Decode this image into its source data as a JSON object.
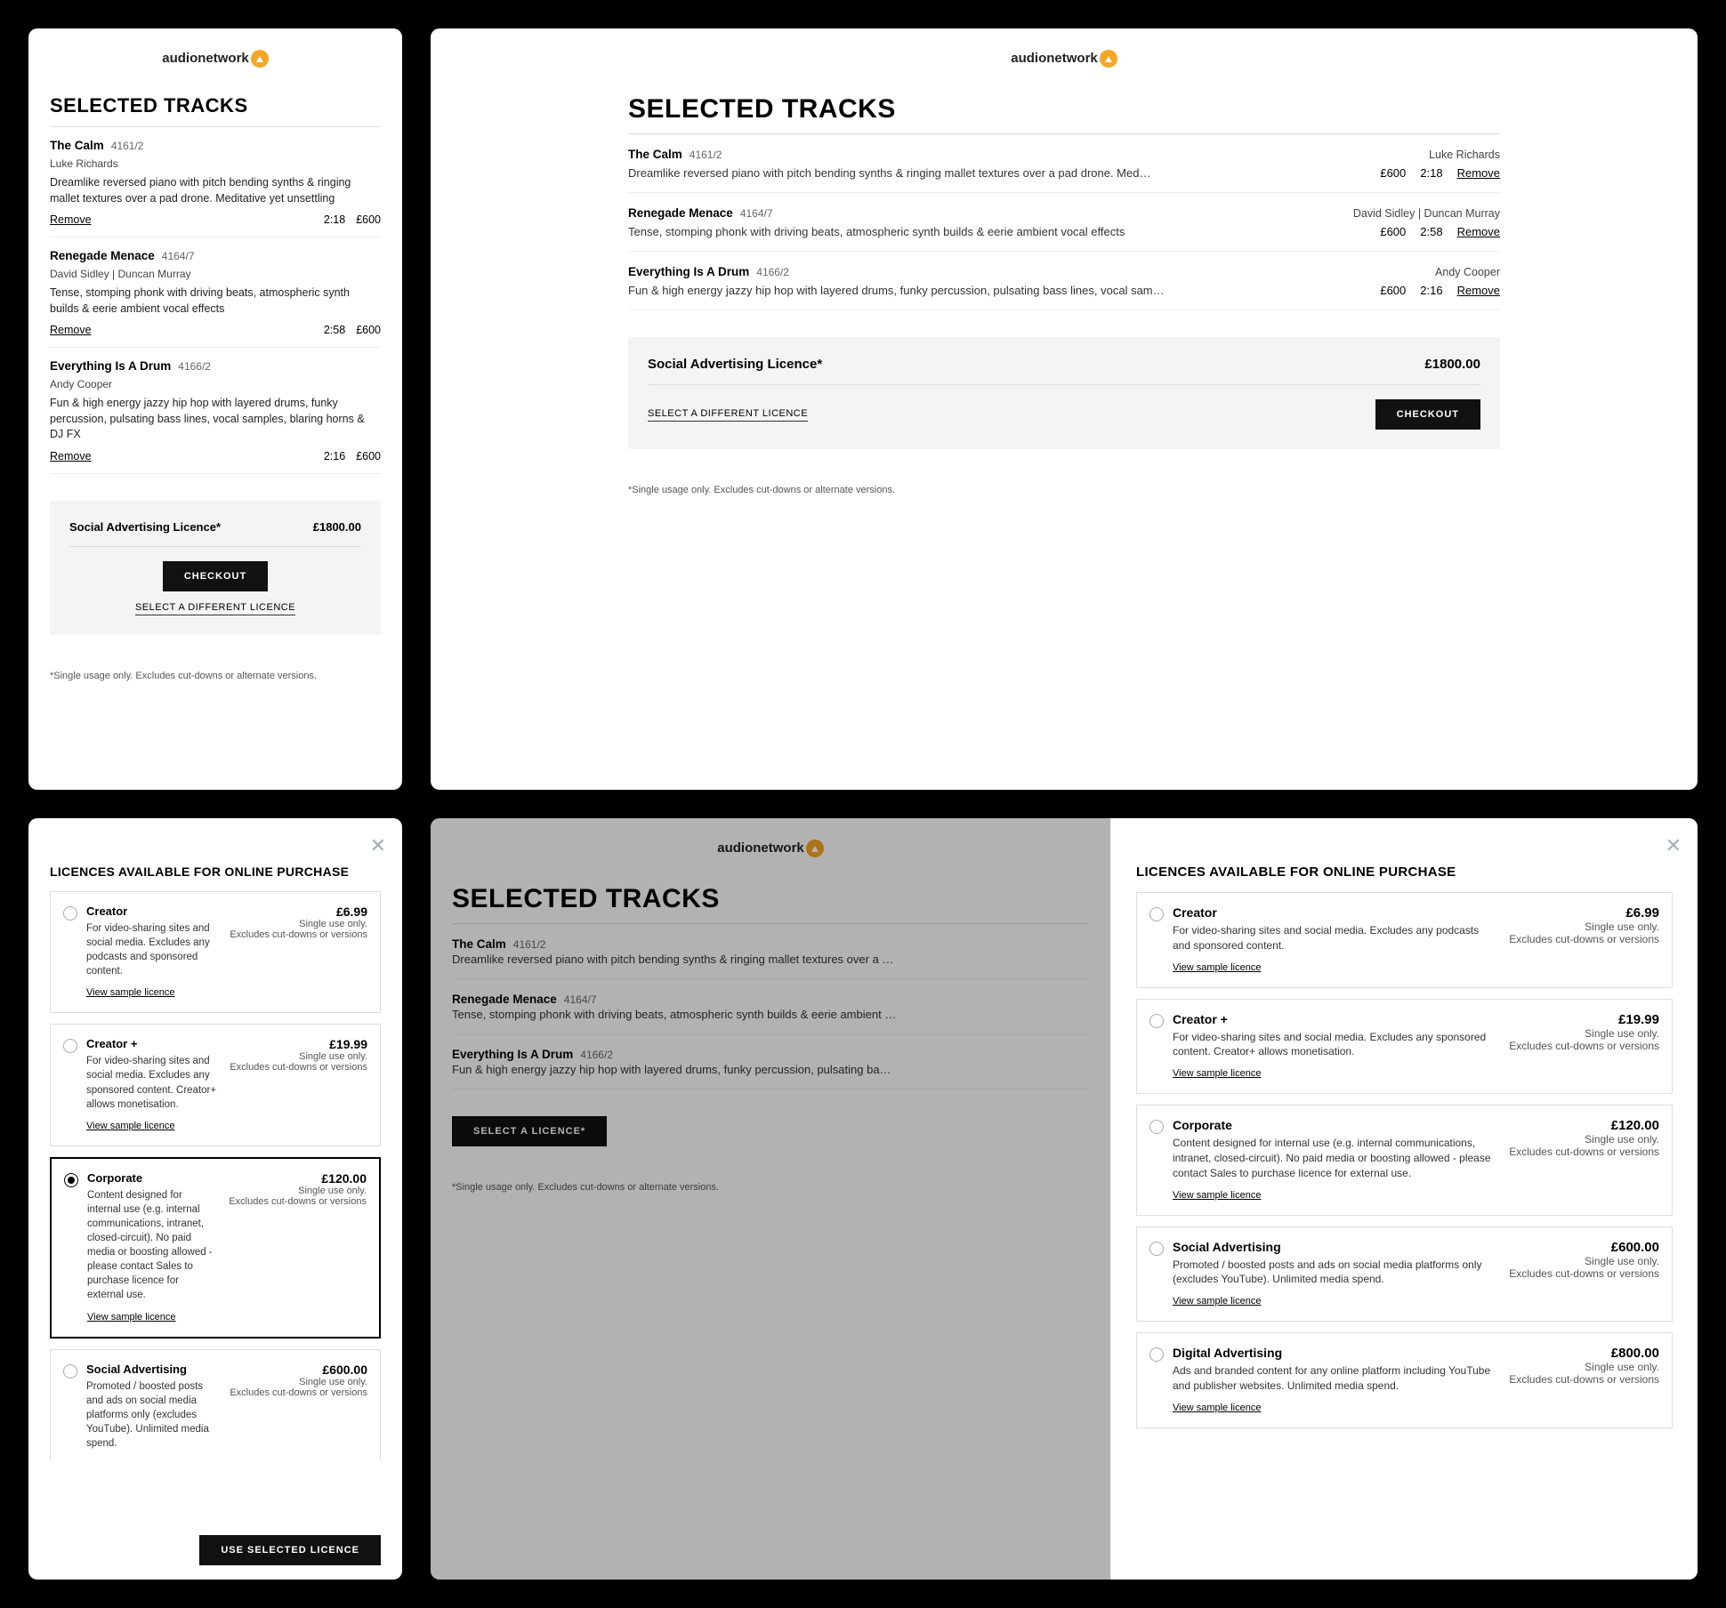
{
  "brand": {
    "prefix": "audio",
    "suffix": "network"
  },
  "page_title": "SELECTED TRACKS",
  "remove_label": "Remove",
  "footnote": "*Single usage only. Excludes cut-downs or alternate versions.",
  "tracks": [
    {
      "title": "The Calm",
      "id": "4161/2",
      "artists": "Luke Richards",
      "desc_full": "Dreamlike reversed piano with pitch bending synths & ringing mallet textures over a pad drone. Meditative yet unsettling",
      "desc_trunc": "Dreamlike reversed piano with pitch bending synths & ringing mallet textures over a pad drone. Med…",
      "duration": "2:18",
      "price": "£600"
    },
    {
      "title": "Renegade Menace",
      "id": "4164/7",
      "artists": "David Sidley  |  Duncan Murray",
      "desc_full": "Tense, stomping phonk with driving beats, atmospheric synth builds & eerie ambient vocal effects",
      "desc_trunc": "Tense, stomping phonk with driving beats, atmospheric synth builds & eerie ambient vocal effects",
      "duration": "2:58",
      "price": "£600"
    },
    {
      "title": "Everything Is A Drum",
      "id": "4166/2",
      "artists": "Andy Cooper",
      "desc_full": "Fun & high energy jazzy hip hop with layered drums, funky percussion, pulsating bass lines, vocal samples, blaring horns & DJ FX",
      "desc_trunc": "Fun & high energy jazzy hip hop with layered drums, funky percussion, pulsating bass lines, vocal sam…",
      "duration": "2:16",
      "price": "£600"
    }
  ],
  "summary": {
    "licence_label": "Social Advertising Licence*",
    "total": "£1800.00",
    "checkout": "CHECKOUT",
    "select_different": "SELECT A DIFFERENT LICENCE",
    "select_licence": "SELECT A LICENCE*"
  },
  "licence_modal": {
    "title": "LICENCES AVAILABLE FOR ONLINE PURCHASE",
    "view_sample": "View sample licence",
    "use_selected": "USE SELECTED LICENCE",
    "terms_suffix_single": "Single use only.",
    "terms_suffix_exclude": "Excludes cut-downs or versions",
    "licences": [
      {
        "name": "Creator",
        "desc": "For video-sharing sites and social media. Excludes any podcasts and sponsored content.",
        "price": "£6.99"
      },
      {
        "name": "Creator +",
        "desc": "For video-sharing sites and social media. Excludes any sponsored content. Creator+ allows monetisation.",
        "price": "£19.99"
      },
      {
        "name": "Corporate",
        "desc": "Content designed for internal use (e.g. internal communications, intranet, closed-circuit). No paid media or boosting allowed - please contact Sales to purchase licence for external use.",
        "price": "£120.00"
      },
      {
        "name": "Social Advertising",
        "desc": "Promoted / boosted posts and ads on social media platforms only (excludes YouTube). Unlimited media spend.",
        "price": "£600.00"
      },
      {
        "name": "Digital Advertising",
        "desc": "Ads and branded content for any online platform including YouTube and publisher websites. Unlimited media spend.",
        "price": "£800.00"
      }
    ]
  }
}
